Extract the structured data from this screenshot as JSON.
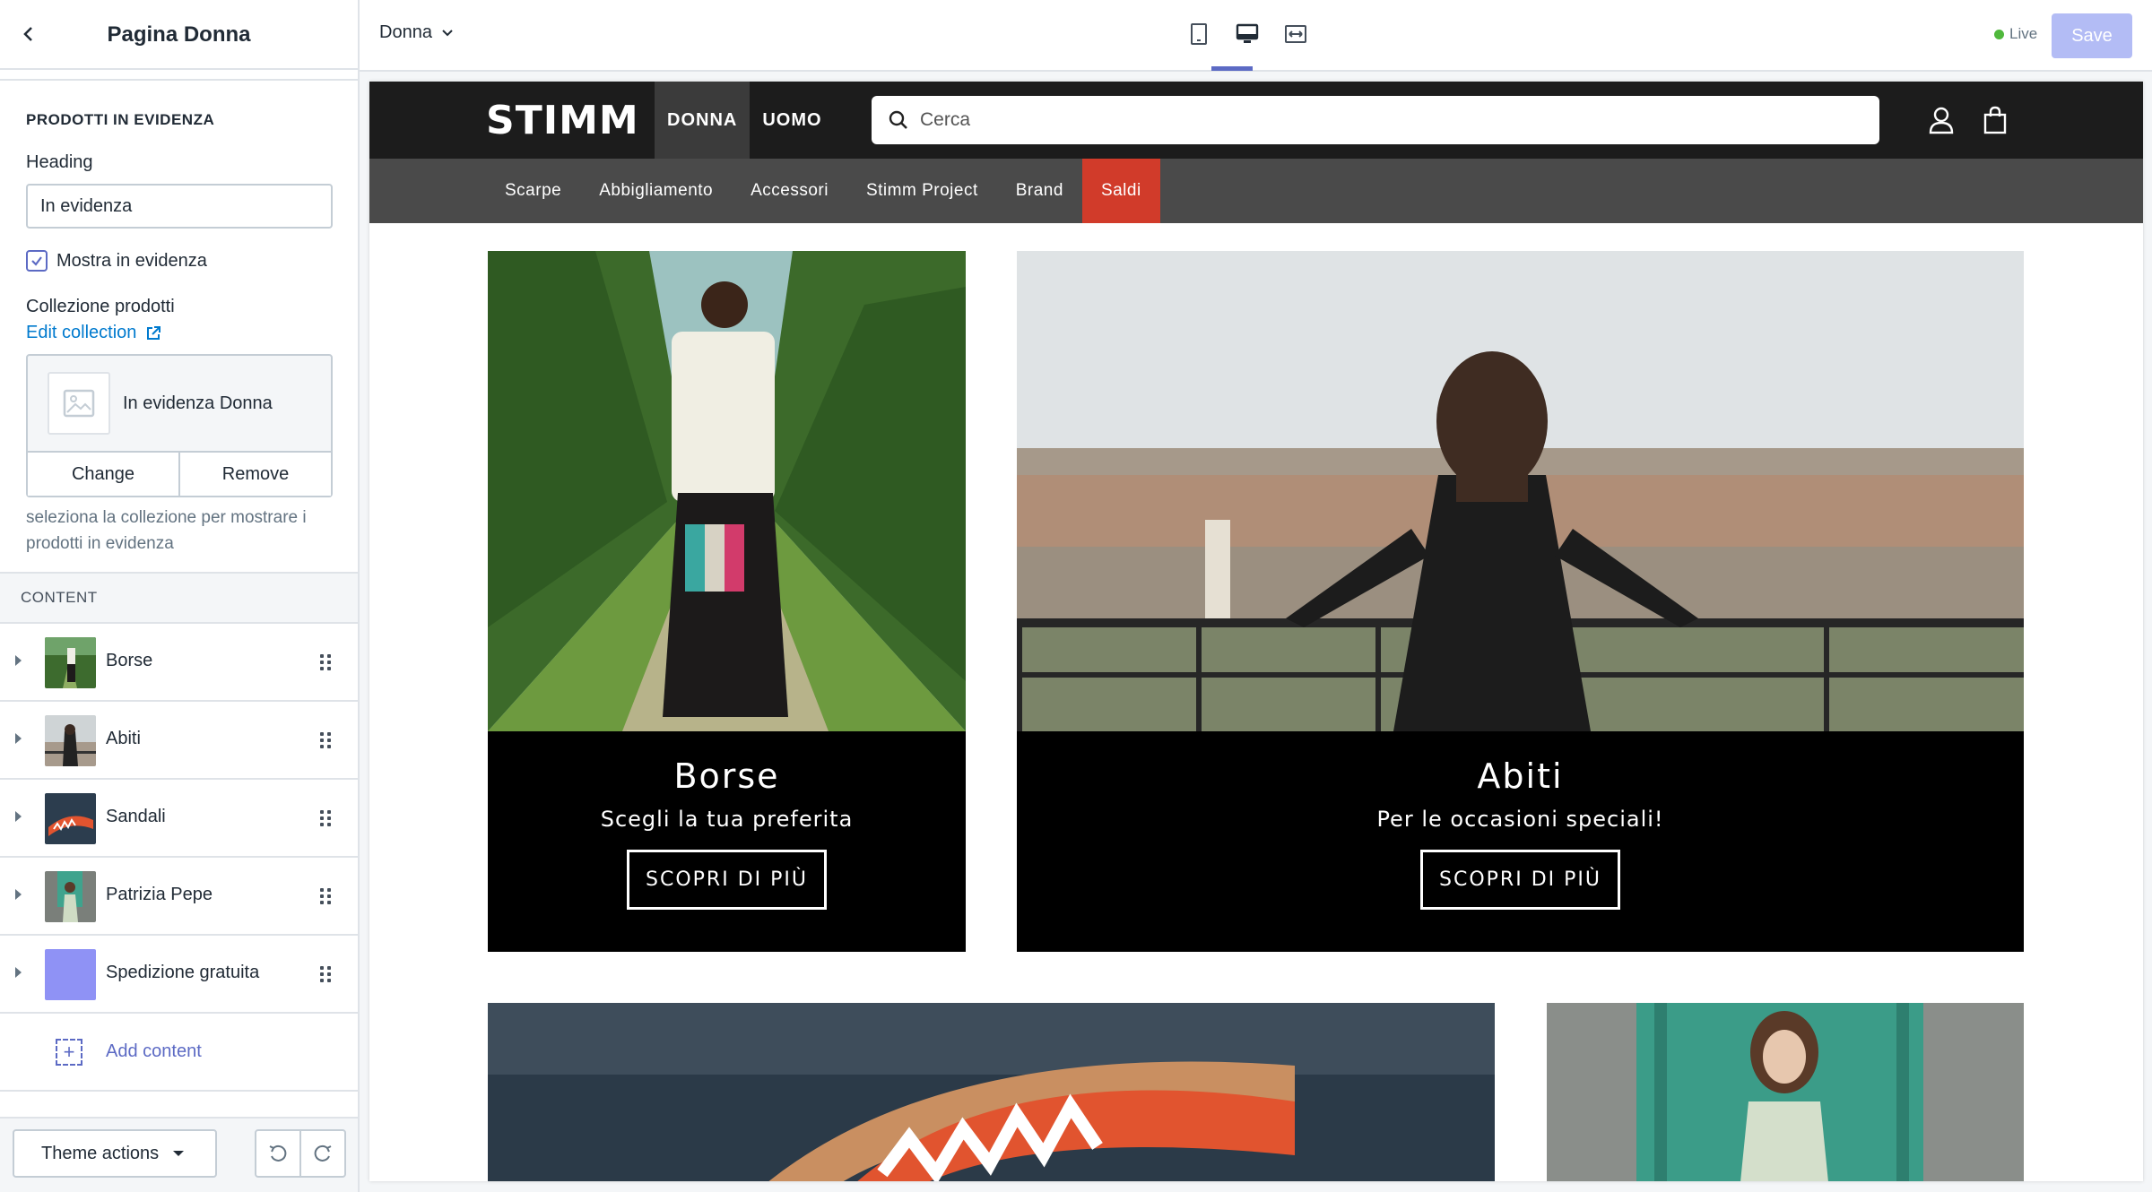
{
  "sidebar": {
    "title": "Pagina Donna",
    "section": {
      "title": "PRODOTTI IN EVIDENZA",
      "heading_label": "Heading",
      "heading_value": "In evidenza",
      "checkbox_label": "Mostra in evidenza",
      "checkbox_checked": true,
      "collection_label": "Collezione prodotti",
      "edit_link": "Edit collection",
      "collection_name": "In evidenza Donna",
      "change_label": "Change",
      "remove_label": "Remove",
      "help_text": "seleziona la collezione per mostrare i prodotti in evidenza"
    },
    "content_header": "CONTENT",
    "content_items": [
      {
        "label": "Borse"
      },
      {
        "label": "Abiti"
      },
      {
        "label": "Sandali"
      },
      {
        "label": "Patrizia Pepe"
      },
      {
        "label": "Spedizione gratuita"
      }
    ],
    "add_content": "Add content",
    "theme_actions": "Theme actions"
  },
  "topbar": {
    "page_select": "Donna",
    "live_label": "Live",
    "save_label": "Save",
    "colors": {
      "accent": "#5c6ac4",
      "save_disabled": "#b3bcf5",
      "live": "#50b83c"
    }
  },
  "store": {
    "logo": "STIMM",
    "nav_top": [
      "DONNA",
      "UOMO"
    ],
    "search_placeholder": "Cerca",
    "subnav": [
      "Scarpe",
      "Abbigliamento",
      "Accessori",
      "Stimm Project",
      "Brand",
      "Saldi"
    ],
    "sale_color": "#d13b2a",
    "cards": [
      {
        "title": "Borse",
        "subtitle": "Scegli la tua preferita",
        "button": "SCOPRI DI PIÙ"
      },
      {
        "title": "Abiti",
        "subtitle": "Per le occasioni speciali!",
        "button": "SCOPRI DI PIÙ"
      }
    ]
  }
}
